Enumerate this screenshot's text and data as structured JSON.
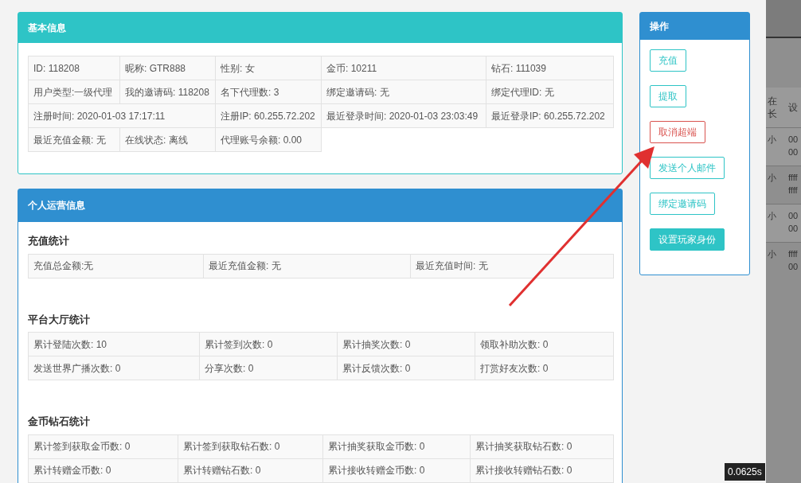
{
  "basic_info": {
    "title": "基本信息",
    "rows": [
      [
        "ID: 118208",
        "昵称: GTR888",
        "性别: 女",
        "金币: 10211",
        "钻石: 111039"
      ],
      [
        "用户类型:一级代理",
        "我的邀请码: 118208",
        "名下代理数: 3",
        "绑定邀请码: 无",
        "绑定代理ID: 无"
      ],
      [
        {
          "text": "注册时间: 2020-01-03 17:17:11",
          "colspan": 2
        },
        "注册IP: 60.255.72.202",
        "最近登录时间: 2020-01-03 23:03:49",
        "最近登录IP: 60.255.72.202"
      ],
      [
        "最近充值金额: 无",
        "在线状态: 离线",
        "代理账号余额: 0.00"
      ]
    ]
  },
  "operations": {
    "title": "个人运营信息",
    "sections": [
      {
        "heading": "充值统计",
        "rows": [
          [
            "充值总金额:无",
            "最近充值金额: 无",
            "最近充值时间: 无"
          ]
        ]
      },
      {
        "heading": "平台大厅统计",
        "rows": [
          [
            "累计登陆次数: 10",
            "累计签到次数: 0",
            "累计抽奖次数: 0",
            "领取补助次数: 0"
          ],
          [
            "发送世界广播次数: 0",
            "分享次数: 0",
            "累计反馈次数: 0",
            "打赏好友次数: 0"
          ]
        ]
      },
      {
        "heading": "金币钻石统计",
        "rows": [
          [
            "累计签到获取金币数: 0",
            "累计签到获取钻石数: 0",
            "累计抽奖获取金币数: 0",
            "累计抽奖获取钻石数: 0"
          ],
          [
            "累计转赠金币数: 0",
            "累计转赠钻石数: 0",
            "累计接收转赠金币数: 0",
            "累计接收转赠钻石数: 0"
          ]
        ]
      }
    ]
  },
  "actions": {
    "title": "操作",
    "buttons": [
      {
        "label": "充值",
        "kind": "outline"
      },
      {
        "label": "提取",
        "kind": "outline"
      },
      {
        "label": "取消超端",
        "kind": "danger"
      },
      {
        "label": "发送个人邮件",
        "kind": "outline"
      },
      {
        "label": "绑定邀请码",
        "kind": "outline"
      },
      {
        "label": "设置玩家身份",
        "kind": "filled"
      }
    ]
  },
  "background_table": {
    "header": [
      "在长",
      "设"
    ],
    "rows": [
      [
        "小",
        "00 00"
      ],
      [
        "小",
        "ffff ffff"
      ],
      [
        "小",
        "00 00"
      ],
      [
        "小",
        "ffff 00"
      ]
    ]
  },
  "timer_badge": "0.0625s"
}
